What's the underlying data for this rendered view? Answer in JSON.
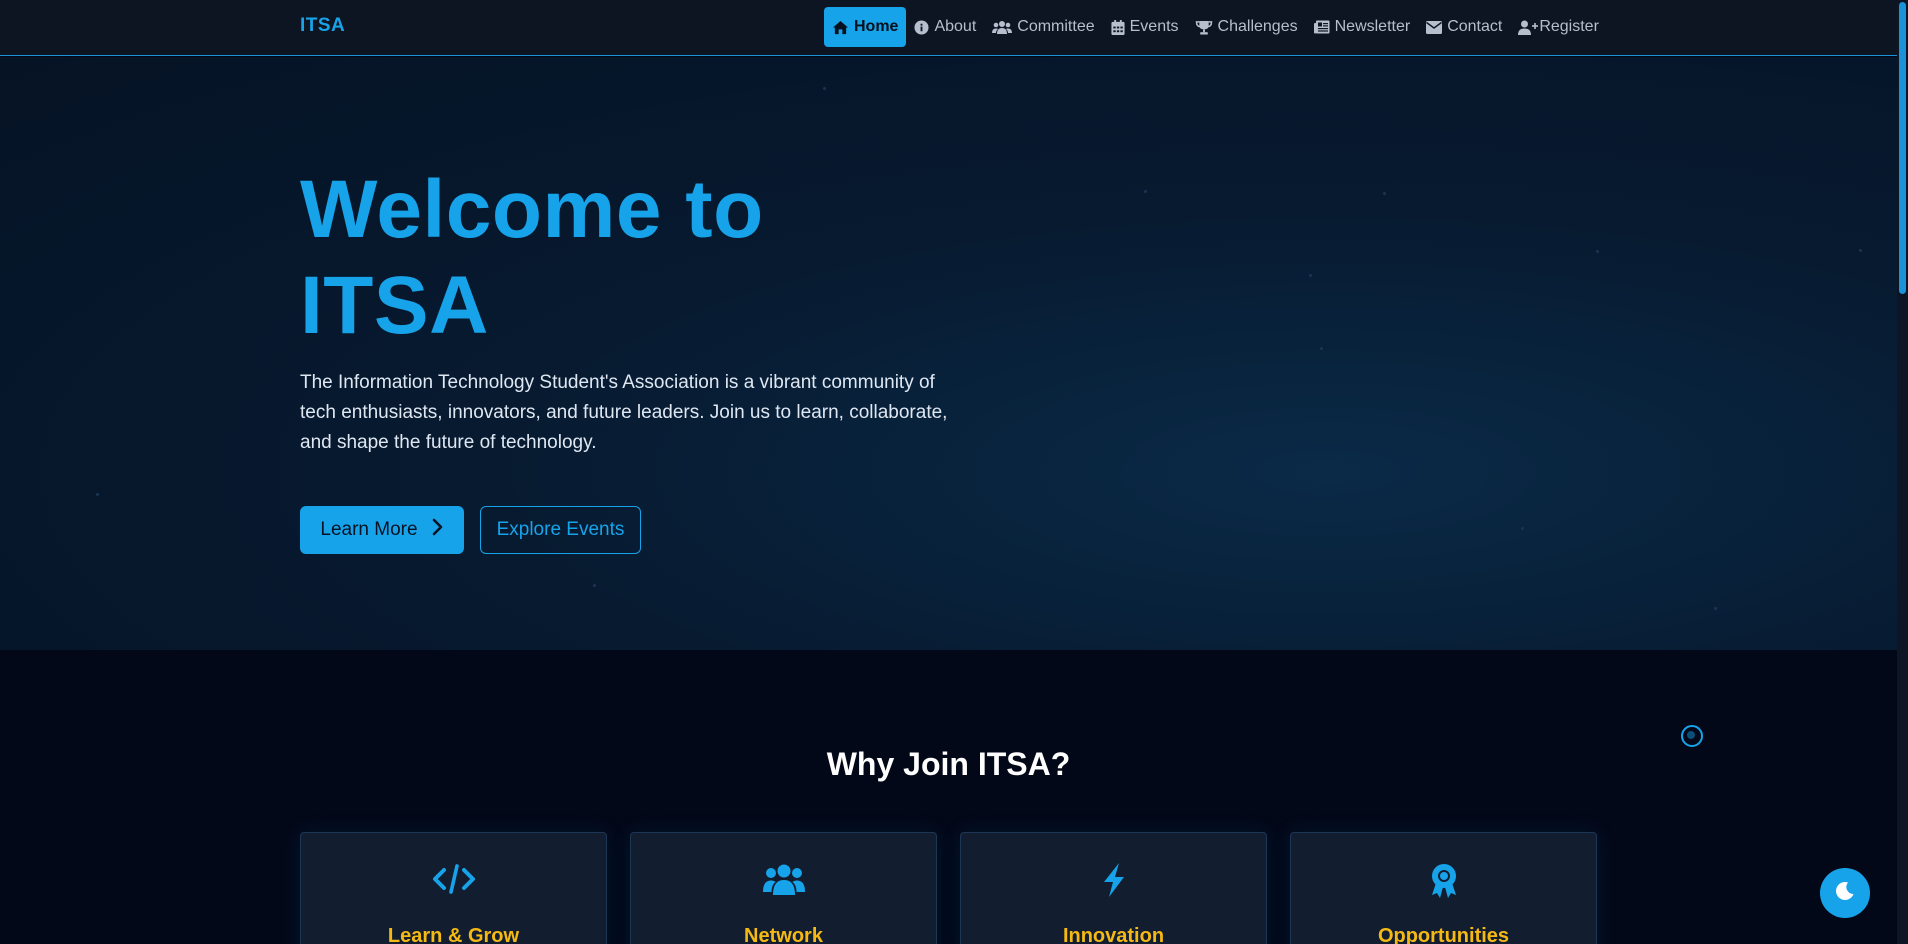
{
  "nav": {
    "brand": "ITSA",
    "items": [
      {
        "label": "Home",
        "icon": "home-icon"
      },
      {
        "label": "About",
        "icon": "info-icon"
      },
      {
        "label": "Committee",
        "icon": "users-icon"
      },
      {
        "label": "Events",
        "icon": "calendar-icon"
      },
      {
        "label": "Challenges",
        "icon": "trophy-icon"
      },
      {
        "label": "Newsletter",
        "icon": "newspaper-icon"
      },
      {
        "label": "Contact",
        "icon": "envelope-icon"
      },
      {
        "label": "Register",
        "icon": "user-plus-icon"
      }
    ],
    "active": "Home"
  },
  "hero": {
    "title_line1": "Welcome to",
    "title_line2": "ITSA",
    "description": "The Information Technology Student's Association is a vibrant community of tech enthusiasts, innovators, and future leaders. Join us to learn, collaborate, and shape the future of technology.",
    "primary_button": "Learn More",
    "secondary_button": "Explore Events"
  },
  "why_join": {
    "title": "Why Join ITSA?",
    "cards": [
      {
        "title": "Learn & Grow",
        "icon": "code-icon"
      },
      {
        "title": "Network",
        "icon": "users-icon"
      },
      {
        "title": "Innovation",
        "icon": "bolt-icon"
      },
      {
        "title": "Opportunities",
        "icon": "award-icon"
      }
    ]
  },
  "colors": {
    "accent": "#17a3ea",
    "card_title": "#f5b914",
    "background": "#030818",
    "hero_background": "#071a30"
  },
  "theme_toggle_icon": "moon-icon"
}
